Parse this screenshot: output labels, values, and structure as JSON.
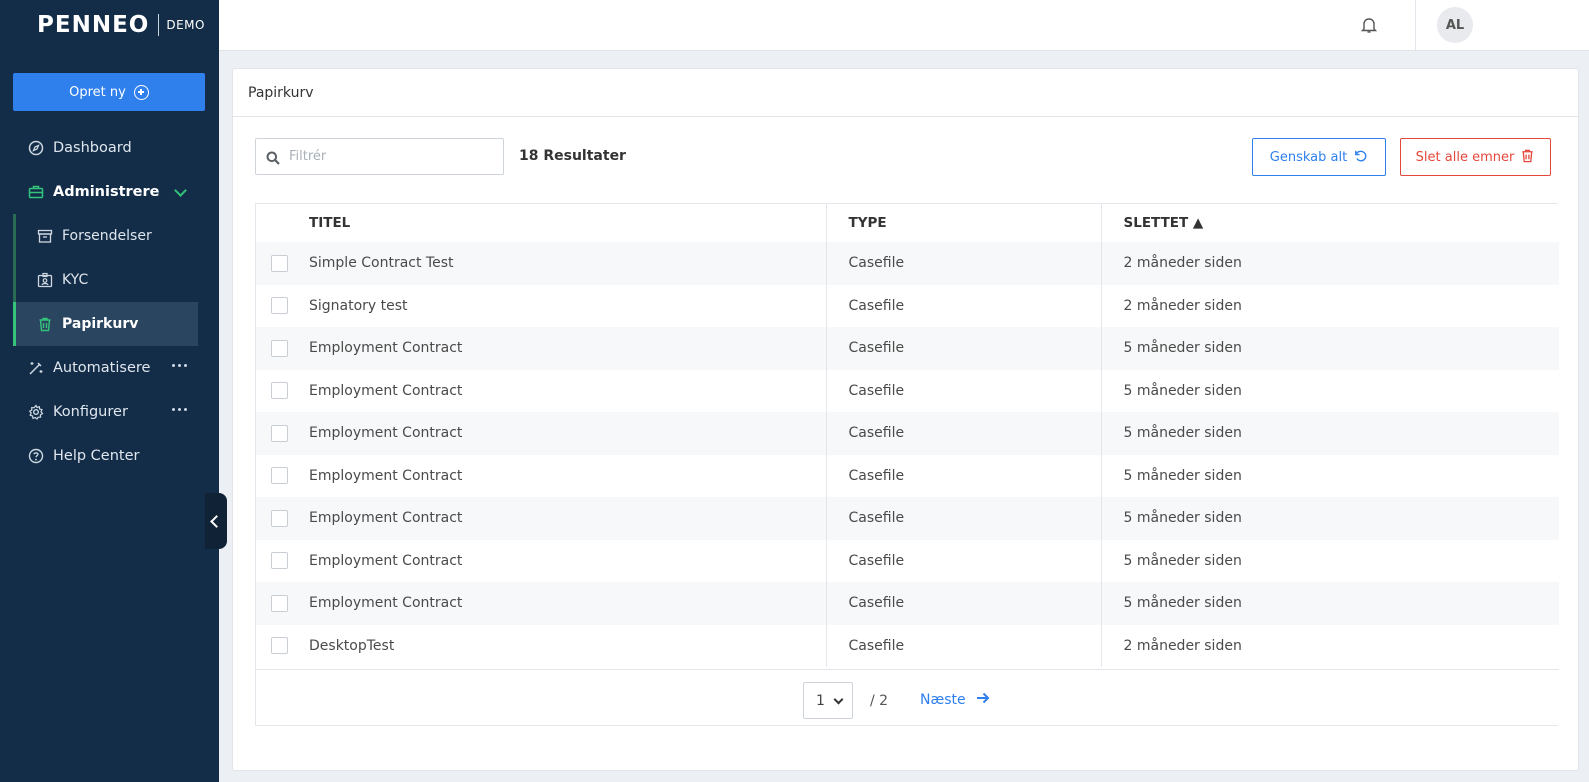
{
  "brand": {
    "logo": "PENNEO",
    "tag": "DEMO"
  },
  "sidebar": {
    "create_label": "Opret ny",
    "items": [
      {
        "label": "Dashboard",
        "icon": "compass-icon"
      },
      {
        "label": "Administrere",
        "icon": "briefcase-icon"
      },
      {
        "label": "Forsendelser",
        "icon": "archive-icon"
      },
      {
        "label": "KYC",
        "icon": "id-badge-icon"
      },
      {
        "label": "Papirkurv",
        "icon": "trash-icon"
      },
      {
        "label": "Automatisere",
        "icon": "magic-wand-icon"
      },
      {
        "label": "Konfigurer",
        "icon": "gear-icon"
      },
      {
        "label": "Help Center",
        "icon": "help-circle-icon"
      }
    ]
  },
  "topbar": {
    "avatar_initials": "AL"
  },
  "page": {
    "title": "Papirkurv",
    "filter_placeholder": "Filtrér",
    "results": "18 Resultater",
    "restore_label": "Genskab alt",
    "delete_label": "Slet alle emner"
  },
  "table": {
    "columns": [
      "TITEL",
      "TYPE",
      "SLETTET ▲"
    ],
    "rows": [
      {
        "title": "Simple Contract Test",
        "type": "Casefile",
        "deleted": "2 måneder siden"
      },
      {
        "title": "Signatory test",
        "type": "Casefile",
        "deleted": "2 måneder siden"
      },
      {
        "title": "Employment Contract",
        "type": "Casefile",
        "deleted": "5 måneder siden"
      },
      {
        "title": "Employment Contract",
        "type": "Casefile",
        "deleted": "5 måneder siden"
      },
      {
        "title": "Employment Contract",
        "type": "Casefile",
        "deleted": "5 måneder siden"
      },
      {
        "title": "Employment Contract",
        "type": "Casefile",
        "deleted": "5 måneder siden"
      },
      {
        "title": "Employment Contract",
        "type": "Casefile",
        "deleted": "5 måneder siden"
      },
      {
        "title": "Employment Contract",
        "type": "Casefile",
        "deleted": "5 måneder siden"
      },
      {
        "title": "Employment Contract",
        "type": "Casefile",
        "deleted": "5 måneder siden"
      },
      {
        "title": "DesktopTest",
        "type": "Casefile",
        "deleted": "2 måneder siden"
      }
    ]
  },
  "pagination": {
    "current": "1",
    "total": "/ 2",
    "next_label": "Næste"
  },
  "colors": {
    "sidebar_bg": "#132d48",
    "accent_blue": "#2f80ed",
    "danger_red": "#e5473a",
    "active_green": "#34c37a"
  }
}
